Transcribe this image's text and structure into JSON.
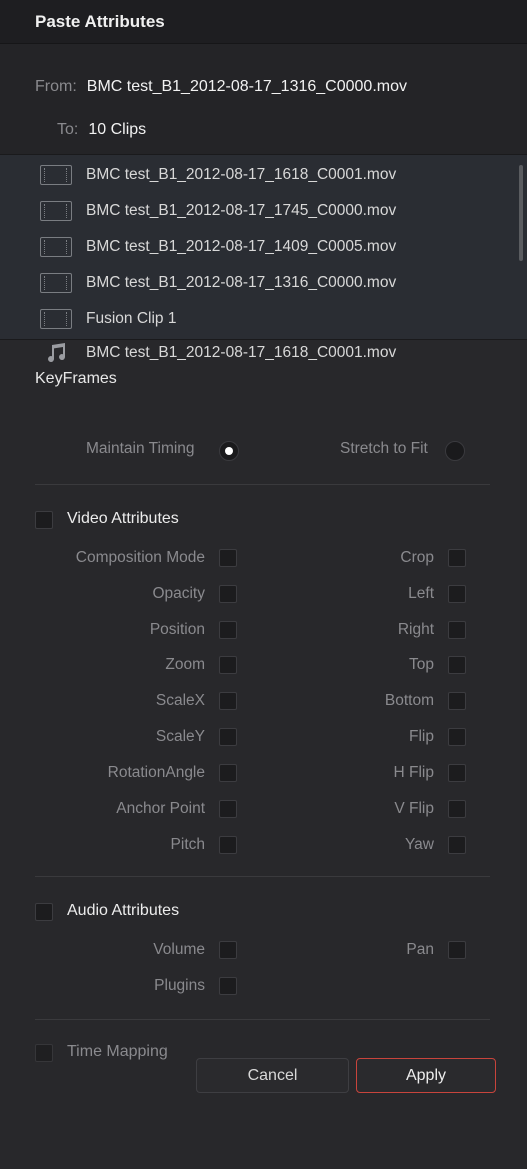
{
  "dialog": {
    "title": "Paste Attributes"
  },
  "from": {
    "label": "From:",
    "value": "BMC test_B1_2012-08-17_1316_C0000.mov"
  },
  "to": {
    "label": "To:",
    "value": "10 Clips"
  },
  "clips": [
    {
      "name": "BMC test_B1_2012-08-17_1618_C0001.mov",
      "icon": "film-clip-icon"
    },
    {
      "name": "BMC test_B1_2012-08-17_1745_C0000.mov",
      "icon": "film-clip-icon"
    },
    {
      "name": "BMC test_B1_2012-08-17_1409_C0005.mov",
      "icon": "film-clip-icon"
    },
    {
      "name": "BMC test_B1_2012-08-17_1316_C0000.mov",
      "icon": "film-clip-icon"
    },
    {
      "name": "Fusion Clip 1",
      "icon": "film-clip-icon"
    },
    {
      "name": "BMC test_B1_2012-08-17_1618_C0001.mov",
      "icon": "music-note-icon"
    }
  ],
  "keyframes": {
    "title": "KeyFrames",
    "maintain_timing": "Maintain Timing",
    "stretch_to_fit": "Stretch to Fit",
    "selected": "Maintain Timing"
  },
  "video": {
    "title": "Video Attributes",
    "left": [
      "Composition Mode",
      "Opacity",
      "Position",
      "Zoom",
      "ScaleX",
      "ScaleY",
      "RotationAngle",
      "Anchor Point",
      "Pitch"
    ],
    "right": [
      "Crop",
      "Left",
      "Right",
      "Top",
      "Bottom",
      "Flip",
      "H Flip",
      "V Flip",
      "Yaw"
    ]
  },
  "audio": {
    "title": "Audio Attributes",
    "volume": "Volume",
    "pan": "Pan",
    "plugins": "Plugins"
  },
  "time_mapping": {
    "label": "Time Mapping"
  },
  "buttons": {
    "cancel": "Cancel",
    "apply": "Apply"
  },
  "colors": {
    "apply_border": "#c8443c",
    "background": "#28282b",
    "clip_list_bg": "#2a2d33"
  }
}
